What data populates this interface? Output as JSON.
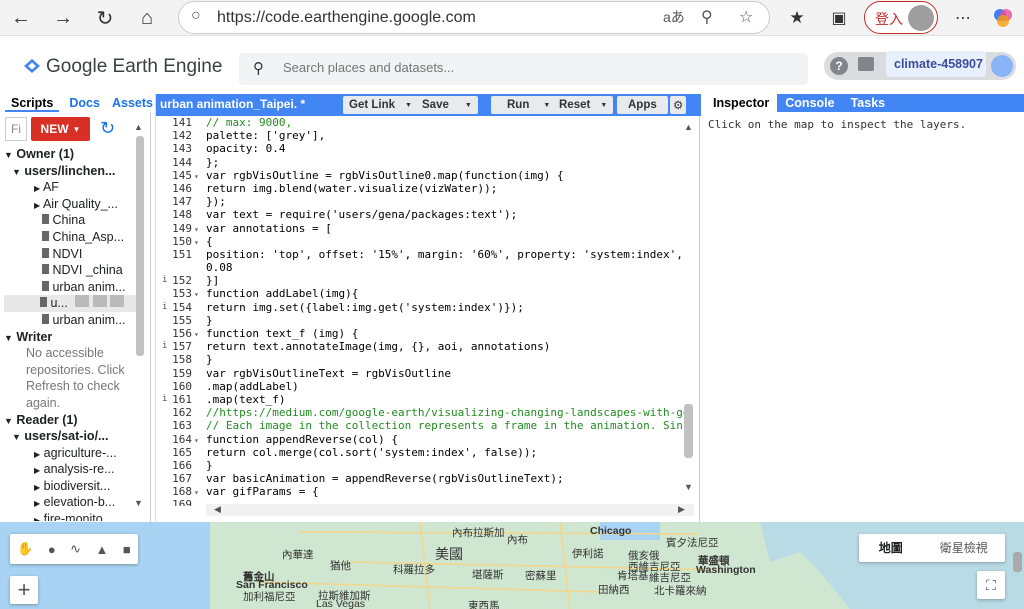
{
  "browser": {
    "url": "https://code.earthengine.google.com",
    "signin_label": "登入",
    "icons": [
      "back-icon",
      "forward-icon",
      "reload-icon",
      "home-icon",
      "lock-icon",
      "read-aloud-icon",
      "zoom-icon",
      "favorite-icon",
      "favorites-icon",
      "collections-icon",
      "menu-icon",
      "copilot-icon"
    ]
  },
  "header": {
    "logo": "Google Earth Engine",
    "search_placeholder": "Search places and datasets...",
    "project": "climate-458907"
  },
  "left_panel": {
    "tabs": [
      "Scripts",
      "Docs",
      "Assets"
    ],
    "filter_placeholder": "Fi",
    "new_label": "NEW",
    "owner_header": "Owner (1)",
    "owner_user": "users/linchen...",
    "owner_items": [
      "AF",
      "Air Quality_...",
      "China",
      "China_Asp...",
      "NDVI",
      "NDVI _china",
      "urban anim...",
      "u...",
      "urban anim..."
    ],
    "writer_header": "Writer",
    "writer_note": [
      "No accessible",
      "repositories. Click",
      "Refresh to check",
      "again."
    ],
    "reader_header": "Reader (1)",
    "reader_user": "users/sat-io/...",
    "reader_items": [
      "agriculture-...",
      "analysis-re...",
      "biodiversit...",
      "elevation-b...",
      "fire-monito..."
    ]
  },
  "editor": {
    "title": "urban animation_Taipei. *",
    "buttons": [
      "Get Link",
      "Save",
      "Run",
      "Reset",
      "Apps"
    ],
    "lines": [
      {
        "n": "141",
        "t": "// max: 9000,"
      },
      {
        "n": "142",
        "t": "palette: ['grey'],"
      },
      {
        "n": "143",
        "t": "opacity: 0.4"
      },
      {
        "n": "144",
        "t": "};"
      },
      {
        "n": "145",
        "t": "var rgbVisOutline = rgbVisOutline0.map(function(img) {",
        "f": true
      },
      {
        "n": "146",
        "t": "return img.blend(water.visualize(vizWater));"
      },
      {
        "n": "147",
        "t": "});"
      },
      {
        "n": "148",
        "t": "var text = require('users/gena/packages:text');"
      },
      {
        "n": "149",
        "t": "var annotations = [",
        "f": true
      },
      {
        "n": "150",
        "t": "{",
        "f": true
      },
      {
        "n": "151",
        "t": "position: 'top', offset: '15%', margin: '60%', property: 'system:index', sc"
      },
      {
        "n": "",
        "t": "0.08"
      },
      {
        "n": "152",
        "t": "}]",
        "i": true
      },
      {
        "n": "153",
        "t": "function addLabel(img){",
        "f": true
      },
      {
        "n": "154",
        "t": "return img.set({label:img.get('system:index')});",
        "i": true
      },
      {
        "n": "155",
        "t": "}"
      },
      {
        "n": "156",
        "t": "function text_f (img) {",
        "f": true
      },
      {
        "n": "157",
        "t": "return text.annotateImage(img, {}, aoi, annotations)",
        "i": true
      },
      {
        "n": "158",
        "t": "}"
      },
      {
        "n": "159",
        "t": "var rgbVisOutlineText = rgbVisOutline"
      },
      {
        "n": "160",
        "t": ".map(addLabel)"
      },
      {
        "n": "161",
        "t": ".map(text_f)",
        "i": true
      },
      {
        "n": "162",
        "t": "//https://medium.com/google-earth/visualizing-changing-landscapes-with-goog"
      },
      {
        "n": "163",
        "t": "// Each image in the collection represents a frame in the animation. Since"
      },
      {
        "n": "164",
        "t": "function appendReverse(col) {",
        "f": true
      },
      {
        "n": "165",
        "t": "return col.merge(col.sort('system:index', false));"
      },
      {
        "n": "166",
        "t": "}"
      },
      {
        "n": "167",
        "t": "var basicAnimation = appendReverse(rgbVisOutlineText);"
      },
      {
        "n": "168",
        "t": "var gifParams = {",
        "f": true
      },
      {
        "n": "169",
        "t": ""
      }
    ]
  },
  "right_panel": {
    "tabs": [
      "Inspector",
      "Console",
      "Tasks"
    ],
    "message": "Click on the map to inspect the layers."
  },
  "map": {
    "type_buttons": [
      "地圖",
      "衛星檢視"
    ],
    "labels": [
      "內布拉斯加",
      "Chicago",
      "賓夕法尼亞",
      "內華達",
      "內布",
      "美國",
      "俄亥俄",
      "華盛頓",
      "Washington",
      "舊金山",
      "San Francisco",
      "加利福尼亞",
      "拉斯維加斯",
      "Las Vegas",
      "科羅拉多",
      "堪薩斯",
      "密蘇里",
      "肯塔基",
      "西維吉尼亞",
      "維吉尼亞",
      "田納西",
      "北卡羅來納",
      "猶他",
      "東西馬",
      "伊利諾"
    ]
  }
}
